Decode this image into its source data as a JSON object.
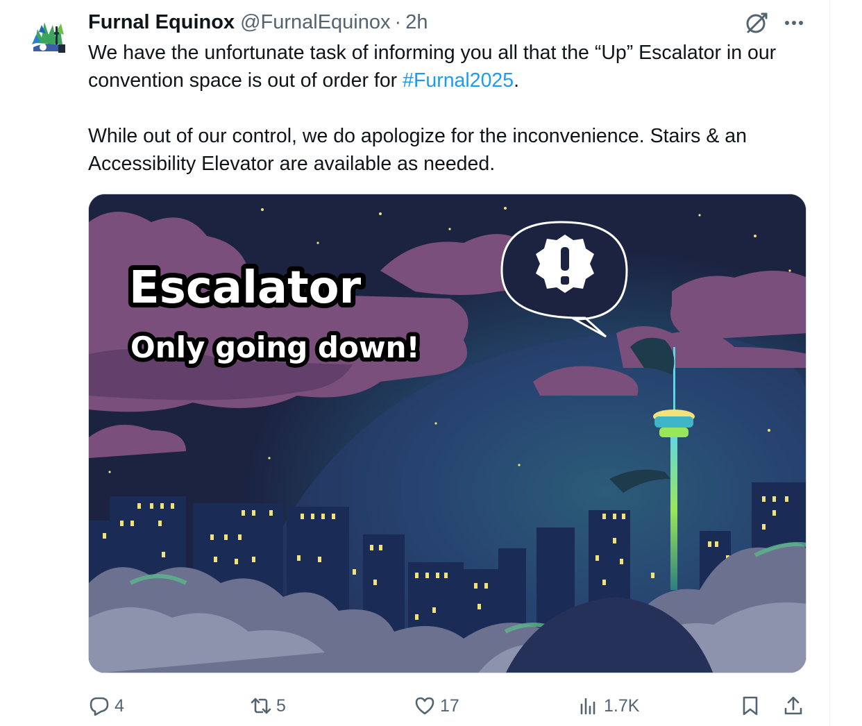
{
  "tweet": {
    "author": {
      "display_name": "Furnal Equinox",
      "handle": "@FurnalEquinox"
    },
    "separator": "·",
    "time": "2h",
    "text": {
      "p1_before": "We have the unfortunate task of informing you all that the “Up” Escalator in our convention space is out of order for ",
      "hashtag": "#Furnal2025",
      "p1_after": ".",
      "p2": "While out of our control, we do apologize for the inconvenience.  Stairs & an Accessibility Elevator are available as needed."
    },
    "media": {
      "headline": "Escalator",
      "subheadline": "Only going down!"
    },
    "actions": {
      "replies": "4",
      "reposts": "5",
      "likes": "17",
      "views": "1.7K"
    }
  },
  "icons": [
    "avatar-logo",
    "grok-icon",
    "more-icon",
    "reply-icon",
    "retweet-icon",
    "like-icon",
    "views-icon",
    "bookmark-icon",
    "share-icon",
    "alert-icon"
  ],
  "colors": {
    "text": "#0f1419",
    "secondary": "#536471",
    "link": "#1d9bf0",
    "sky": "#1b2340",
    "cloud": "#7a4f7c",
    "window": "#f3e27a"
  }
}
